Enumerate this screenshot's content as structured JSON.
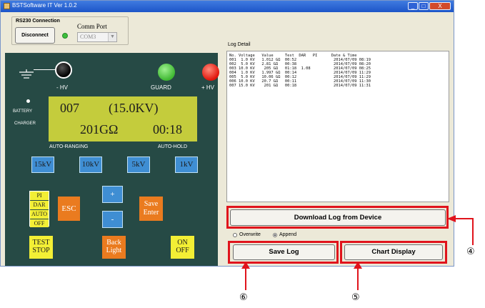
{
  "window": {
    "title": "BSTSoftware IT Ver 1.0.2",
    "min": "_",
    "max": "□",
    "close": "X"
  },
  "connection": {
    "group_title": "RS230 Connection",
    "disconnect_label": "Disconnect",
    "comm_port_label": "Comm Port",
    "comm_port_value": "COM3",
    "status_color": "#3cbf3c"
  },
  "device": {
    "labels": {
      "neg_hv": "- HV",
      "guard": "GUARD",
      "pos_hv": "+ HV",
      "battery": "BATTERY",
      "charger": "CHARGER",
      "auto_ranging": "AUTO-RANGING",
      "auto_hold": "AUTO-HOLD"
    },
    "lcd": {
      "line1_left": "007",
      "line1_right": "(15.0KV)",
      "line2_left": "201GΩ",
      "line2_right": "00:18"
    },
    "voltage_buttons": [
      "15kV",
      "10kV",
      "5kV",
      "1kV"
    ],
    "modes": [
      "PI",
      "DAR",
      "AUTO",
      "OFF"
    ],
    "esc_label": "ESC",
    "plus_label": "+",
    "minus_label": "-",
    "save_enter": [
      "Save",
      "Enter"
    ],
    "test_stop": [
      "TEST",
      "STOP"
    ],
    "back_light": [
      "Back",
      "Light"
    ],
    "on_off": [
      "ON",
      "OFF"
    ]
  },
  "log": {
    "label": "Log Detail",
    "lines": [
      "No. Voltage   Value     Test  DAR   PI      Date & Time",
      "001  1.0 KV   1.012 GΩ  00:52                2014/07/09 08:19",
      "002  5.0 KV   2.81 GΩ   00:38                2014/07/09 08:20",
      "003 10.0 KV    205 GΩ   01:18  1.08          2014/07/09 08:25",
      "004  1.0 KV   1.997 GΩ  00:14                2014/07/09 11:29",
      "005  5.0 KV   10.06 GΩ  00:12                2014/07/09 11:29",
      "006 10.0 KV   20.7 GΩ   00:11                2014/07/09 11:30",
      "007 15.0 KV    201 GΩ   00:18                2014/07/09 11:31"
    ]
  },
  "actions": {
    "download_label": "Download Log from Device",
    "overwrite_label": "Overwrite",
    "append_label": "Append",
    "selected_mode": "Append",
    "save_log_label": "Save Log",
    "chart_display_label": "Chart Display"
  },
  "callouts": {
    "download": "④",
    "chart": "⑤",
    "save": "⑥"
  },
  "colors": {
    "highlight": "#e0141c",
    "panel": "#264a45",
    "lcd": "#c4cc3c"
  }
}
